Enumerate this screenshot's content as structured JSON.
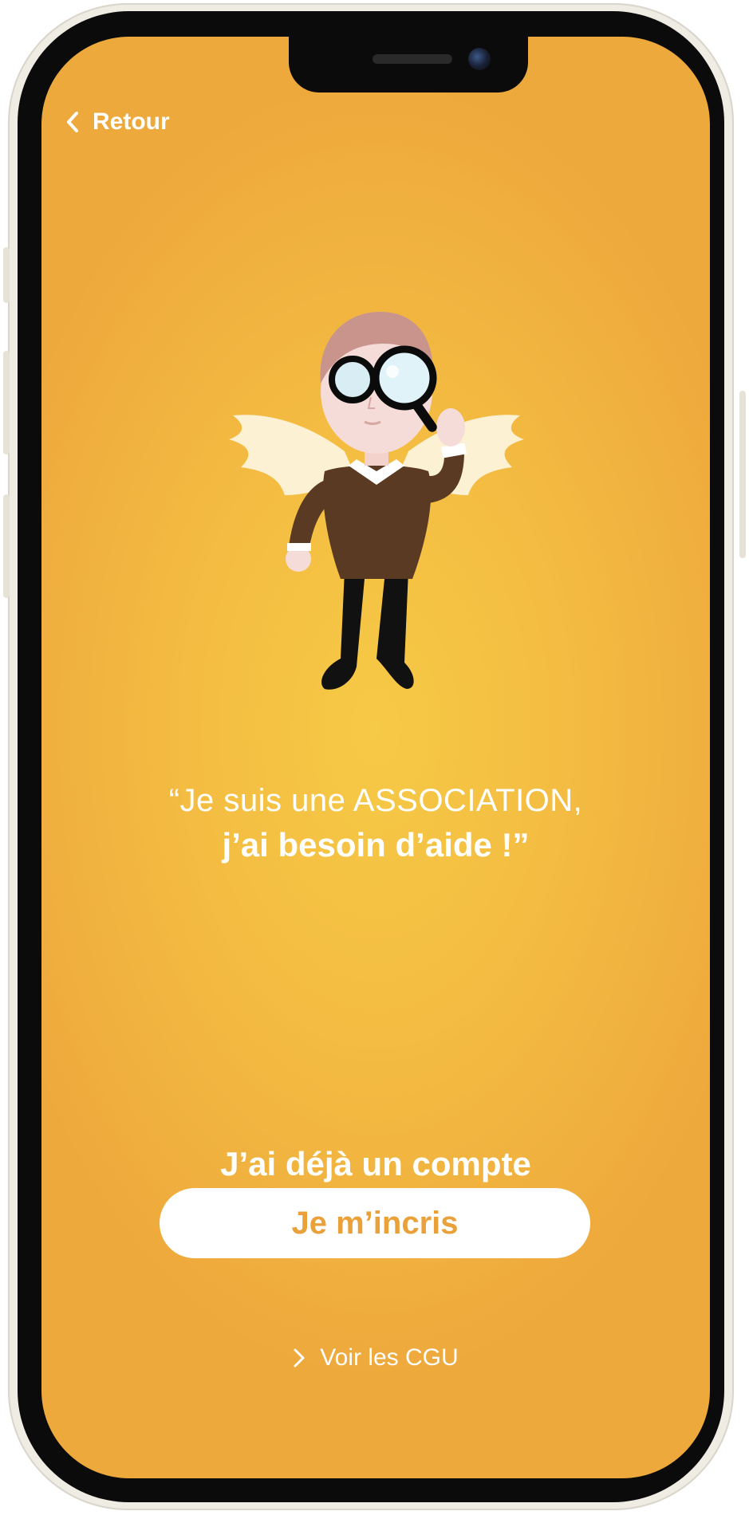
{
  "nav": {
    "back_label": "Retour"
  },
  "main": {
    "quote_line1": "“Je suis une ASSOCIATION,",
    "quote_line2": "j’ai besoin d’aide !”",
    "login_label": "J’ai déjà un compte",
    "signup_label": "Je m’incris",
    "cgu_label": "Voir les CGU"
  },
  "icons": {
    "back": "chevron-left-icon",
    "cgu": "chevron-right-icon",
    "mascot": "angel-mascot-with-magnifier"
  },
  "colors": {
    "background": "#f4bd42",
    "accent_text": "#eba13a",
    "text": "#ffffff"
  }
}
